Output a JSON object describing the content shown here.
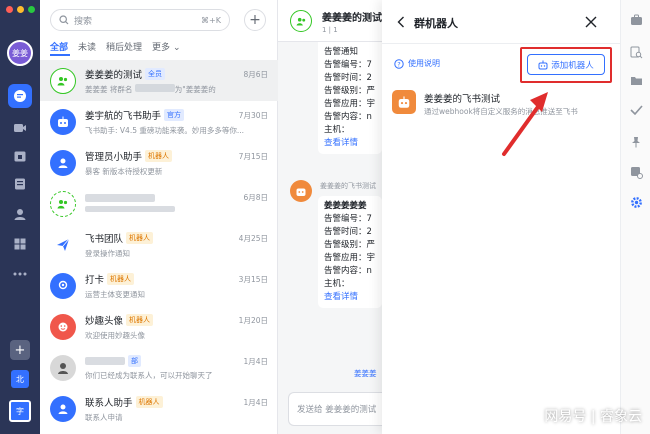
{
  "rail": {
    "avatar": "姜姜",
    "workspace_1": "北",
    "workspace_2": "字",
    "mac_dots": [
      "#ff5f57",
      "#febc2e",
      "#28c840"
    ]
  },
  "list": {
    "search_placeholder": "搜索",
    "search_shortcut": "⌘+K",
    "tabs": [
      "全部",
      "未读",
      "稍后处理",
      "更多"
    ],
    "items": [
      {
        "name": "姜姜姜的测试",
        "badge": "全员",
        "badge_color": "blue",
        "sub": "姜姜姜 将群名",
        "sub_tail": "为\"姜姜姜的",
        "time": "8月6日"
      },
      {
        "name": "姜宇航的飞书助手",
        "badge": "官方",
        "badge_color": "blue",
        "sub": "飞书助手: V4.5 重磅功能来袭。妙用多多等你...",
        "time": "7月30日"
      },
      {
        "name": "管理员小助手",
        "badge": "机器人",
        "badge_color": "orange",
        "sub": "暴客 新版本待授权更新",
        "time": "7月15日"
      },
      {
        "name": "",
        "badge": "",
        "badge_color": "blue",
        "sub": "",
        "time": "6月8日"
      },
      {
        "name": "飞书团队",
        "badge": "机器人",
        "badge_color": "orange",
        "sub": "登录操作通知",
        "time": "4月25日"
      },
      {
        "name": "打卡",
        "badge": "机器人",
        "badge_color": "orange",
        "sub": "运营主体变更通知",
        "time": "3月15日"
      },
      {
        "name": "妙趣头像",
        "badge": "机器人",
        "badge_color": "orange",
        "sub": "欢迎使用妙趣头像",
        "time": "1月20日"
      },
      {
        "name": "",
        "badge": "部",
        "badge_color": "blue",
        "sub": "你们已经成为联系人，可以开始聊天了",
        "time": "1月4日"
      },
      {
        "name": "联系人助手",
        "badge": "机器人",
        "badge_color": "orange",
        "sub": "联系人申请",
        "time": "1月4日"
      }
    ]
  },
  "chat": {
    "title": "姜姜姜的测试",
    "meta": "1 | 1",
    "msg1": [
      "告警通知",
      "告警编号：7",
      "告警时间：2",
      "告警级别：严",
      "告警应用：宇",
      "告警内容：n",
      "主机：",
      "查看详情"
    ],
    "sender": "姜姜姜的飞书测试",
    "msg2": [
      "姜姜姜姜姜",
      "告警编号：7",
      "告警时间：2",
      "告警级别：严",
      "告警应用：宇",
      "告警内容：n",
      "主机：",
      "查看详情"
    ],
    "at_line": "姜姜姜",
    "input_placeholder": "发送给 姜姜姜的测试"
  },
  "panel": {
    "title": "群机器人",
    "help": "使用说明",
    "add_button": "添加机器人",
    "robot_name": "姜姜姜的飞书测试",
    "robot_desc": "通过webhook将自定义服务的消息推送至飞书",
    "highlight_color": "#e02d2d"
  },
  "watermark": "网易号 | 睿象云"
}
